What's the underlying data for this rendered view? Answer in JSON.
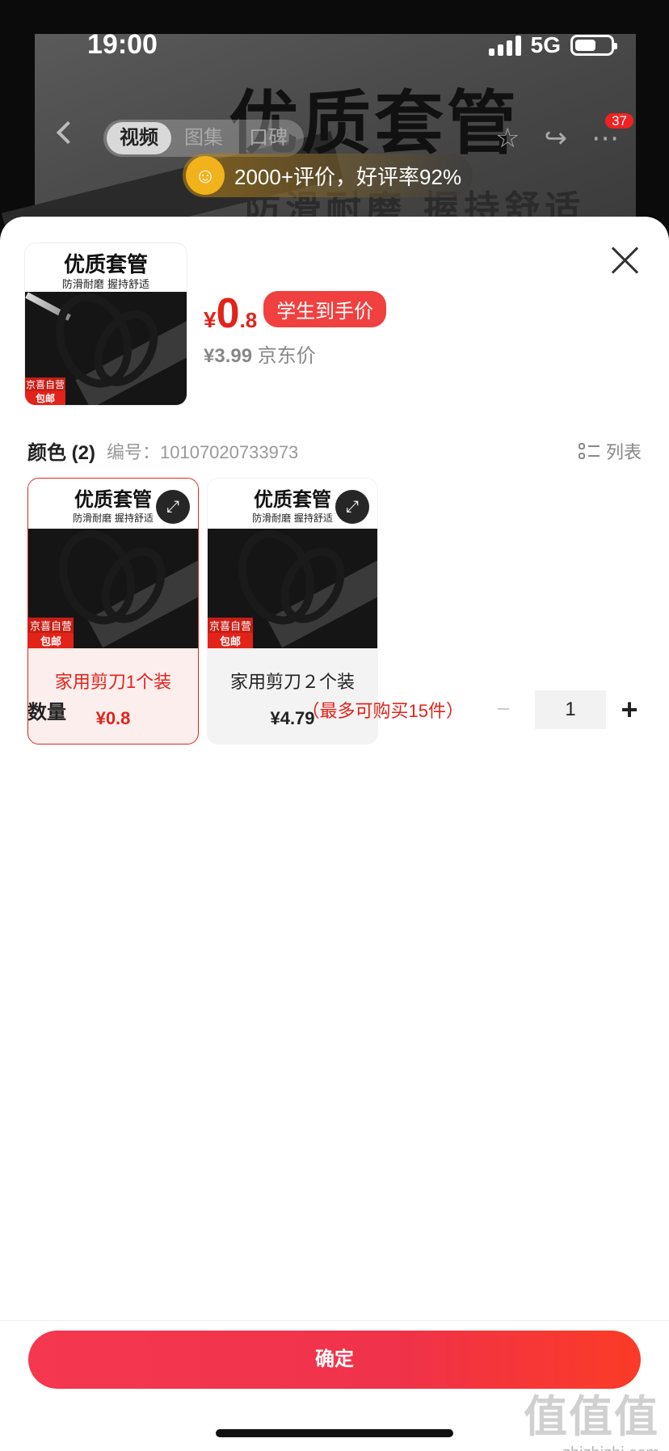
{
  "status_bar": {
    "time": "19:00",
    "network": "5G"
  },
  "background": {
    "hero_title": "优质套管",
    "hero_subtitle": "防滑耐磨  握持舒适",
    "nav_tabs": [
      "视频",
      "图集",
      "口碑"
    ],
    "active_tab": "视频",
    "more_badge": "37",
    "review_summary": "2000+评价，好评率92%"
  },
  "product": {
    "thumb_title": "优质套管",
    "thumb_subtitle": "防滑耐磨  握持舒适",
    "badge_top": "京喜自营",
    "badge_bottom": "包邮",
    "price_currency": "¥",
    "price_integer": "0",
    "price_decimal": ".8",
    "price_tag": "学生到手价",
    "original_price": "¥3.99",
    "original_price_label": "京东价"
  },
  "spec": {
    "label": "颜色 (2)",
    "code": "编号：10107020733973",
    "list_toggle": "列表"
  },
  "options": [
    {
      "name": "家用剪刀1个装",
      "price": "¥0.8",
      "selected": true
    },
    {
      "name": "家用剪刀２个装",
      "price": "¥4.79",
      "selected": false
    }
  ],
  "quantity": {
    "label": "数量",
    "limit": "（最多可购买15件）",
    "value": "1",
    "minus": "−",
    "plus": "+"
  },
  "confirm_label": "确定",
  "watermark": {
    "glyphs": "值值值",
    "url": "zhizhizhi.com"
  },
  "colors": {
    "accent": "#e2231a",
    "button_gradient_start": "#f5374f",
    "button_gradient_end": "#fb3b26"
  }
}
